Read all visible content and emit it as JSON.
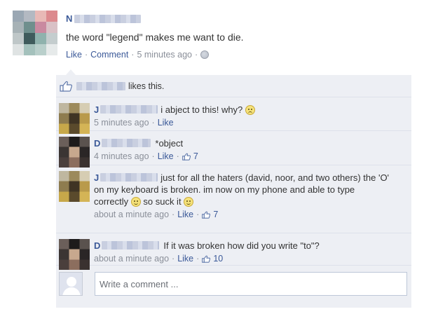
{
  "post": {
    "author_initial": "N",
    "text": "the word \"legend\" makes me want to die.",
    "actions": {
      "like_label": "Like",
      "comment_label": "Comment",
      "timestamp": "5 minutes ago",
      "separator": "·",
      "audience_icon": "globe-icon"
    }
  },
  "likes": {
    "icon": "thumbs-up-icon",
    "text": "likes this."
  },
  "comments": [
    {
      "author_initial": "J",
      "text": "i abject to this! why?",
      "emoticon": "frown-emoticon",
      "timestamp": "5 minutes ago",
      "like_label": "Like"
    },
    {
      "author_initial": "D",
      "text": "*object",
      "timestamp": "4 minutes ago",
      "like_label": "Like",
      "like_count": "7"
    },
    {
      "author_initial": "J",
      "text_line1": "just for all the haters (david, noor, and two others) the 'O'",
      "text_line2": "on my keyboard is broken. im now on my phone and able to type",
      "text_line3a": "correctly",
      "text_line3b": "so suck it",
      "timestamp": "about a minute ago",
      "like_label": "Like",
      "like_count": "7"
    },
    {
      "author_initial": "D",
      "text": "If it was broken how did you write \"to\"?",
      "timestamp": "about a minute ago",
      "like_label": "Like",
      "like_count": "10"
    }
  ],
  "composer": {
    "placeholder": "Write a comment ..."
  },
  "colors": {
    "link": "#3b5998",
    "meta": "#8a8f99",
    "ufi_background": "#edeff4"
  }
}
